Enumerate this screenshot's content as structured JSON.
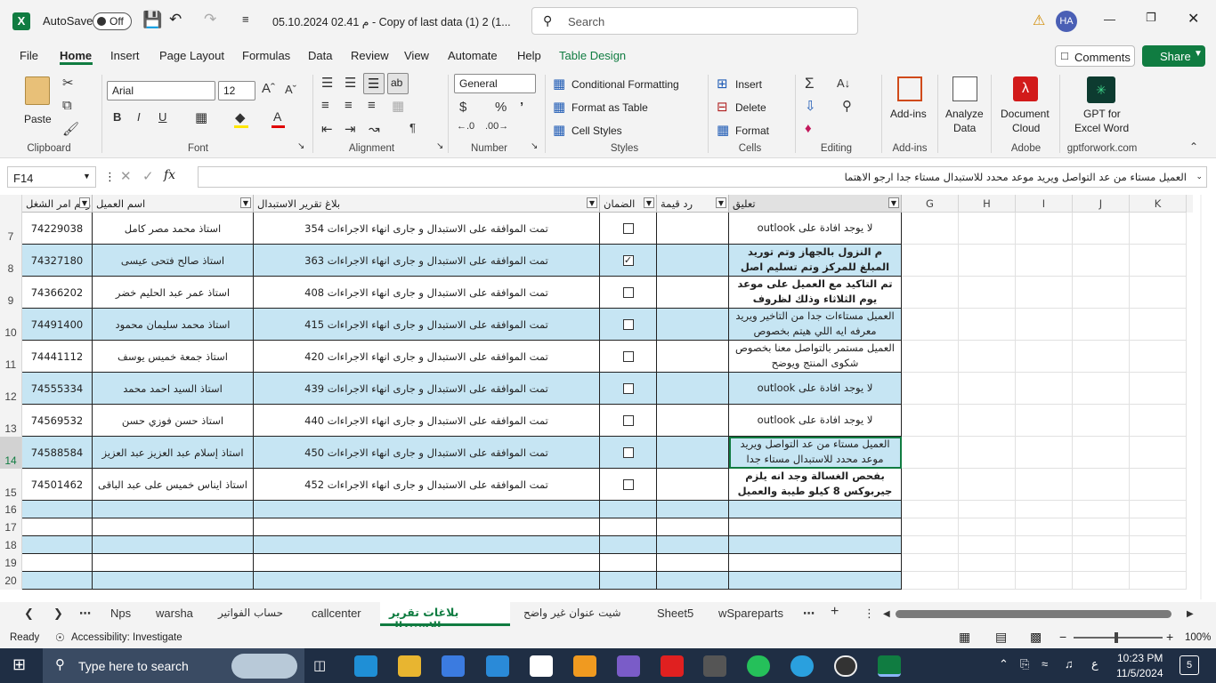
{
  "titlebar": {
    "autosave_label": "AutoSave",
    "autosave_state": "Off",
    "filename": "05.10.2024 02.41 م - Copy of last data (1) 2 (1...",
    "search_placeholder": "Search",
    "user_initials": "HA"
  },
  "menu": [
    "File",
    "Home",
    "Insert",
    "Page Layout",
    "Formulas",
    "Data",
    "Review",
    "View",
    "Automate",
    "Help",
    "Table Design"
  ],
  "menu_right": {
    "comments": "Comments",
    "share": "Share"
  },
  "ribbon": {
    "clipboard": {
      "paste": "Paste",
      "label": "Clipboard"
    },
    "font": {
      "name": "Arial",
      "size": "12",
      "label": "Font"
    },
    "alignment": {
      "label": "Alignment"
    },
    "number": {
      "format": "General",
      "label": "Number"
    },
    "styles": {
      "conditional": "Conditional Formatting",
      "table": "Format as Table",
      "cell": "Cell Styles",
      "label": "Styles"
    },
    "cells": {
      "insert": "Insert",
      "delete": "Delete",
      "format": "Format",
      "label": "Cells"
    },
    "editing": {
      "label": "Editing"
    },
    "addins": {
      "addins": "Add-ins",
      "label": "Add-ins"
    },
    "analyze": {
      "line1": "Analyze",
      "line2": "Data"
    },
    "adobe": {
      "line1": "Document",
      "line2": "Cloud",
      "label": "Adobe"
    },
    "gpt": {
      "line1": "GPT for",
      "line2": "Excel Word",
      "label": "gptforwork.com"
    }
  },
  "formula_bar": {
    "name_box": "F14",
    "fx": "fx",
    "content": "العميل مستاء من عد التواصل ويريد موعد محدد للاستبدال مستاء جدا ارجو الاهتما"
  },
  "headers": {
    "col_order": "رقم امر الشغل",
    "col_name": "اسم العميل",
    "col_report": "بلاغ تقرير الاستبدال",
    "col_warranty": "الضمان",
    "col_value": "رد قيمة",
    "col_comment": "تعليق",
    "letters": [
      "G",
      "H",
      "I",
      "J",
      "K"
    ]
  },
  "rows": [
    {
      "num": "7",
      "order": "74229038",
      "name": "استاذ محمد مصر كامل",
      "report": "تمت الموافقه على الاستبدال و جارى انهاء الاجراءات 354",
      "checked": false,
      "comment": "لا يوجد افادة على outlook"
    },
    {
      "num": "8",
      "order": "74327180",
      "name": "استاذ صالح فتحى عيسى",
      "report": "تمت الموافقه على الاستبدال و جارى انهاء الاجراءات 363",
      "checked": true,
      "comment": "م النزول بالجهاز وتم توريد المبلغ للمركز وتم تسليم اصل"
    },
    {
      "num": "9",
      "order": "74366202",
      "name": "استاذ عمر عبد الحليم خضر",
      "report": "تمت الموافقه على الاستبدال و جارى انهاء الاجراءات 408",
      "checked": false,
      "comment": "تم التاكيد مع العميل على موعد يوم الثلاثاء وذلك لظروف"
    },
    {
      "num": "10",
      "order": "74491400",
      "name": "استاذ محمد سليمان محمود",
      "report": "تمت الموافقه على الاستبدال و جارى انهاء الاجراءات 415",
      "checked": false,
      "comment": "العميل مستاءات جدا من التاخير ويريد معرفه ايه اللي هيتم بخصوص"
    },
    {
      "num": "11",
      "order": "74441112",
      "name": "استاذ جمعة خميس يوسف",
      "report": "تمت الموافقه على الاستبدال و جارى انهاء الاجراءات 420",
      "checked": false,
      "comment": "العميل مستمر بالتواصل معنا بخصوص شكوى المنتج ويوضح"
    },
    {
      "num": "12",
      "order": "74555334",
      "name": "استاذ السيد احمد محمد",
      "report": "تمت الموافقه على الاستبدال و جارى انهاء الاجراءات 439",
      "checked": false,
      "comment": "لا يوجد افادة على outlook"
    },
    {
      "num": "13",
      "order": "74569532",
      "name": "استاذ حسن فوزي حسن",
      "report": "تمت الموافقه على الاستبدال و جارى انهاء الاجراءات 440",
      "checked": false,
      "comment": "لا يوجد افادة على outlook"
    },
    {
      "num": "14",
      "order": "74588584",
      "name": "استاذ إسلام عبد العزيز عبد العزيز",
      "report": "تمت الموافقه على الاستبدال و جارى انهاء الاجراءات 450",
      "checked": false,
      "comment": "العميل مستاء من عد التواصل ويريد موعد محدد للاستبدال مستاء جدا"
    },
    {
      "num": "15",
      "order": "74501462",
      "name": "استاذ  ايناس خميس على عبد الباقى",
      "report": "تمت الموافقه على الاستبدال و جارى انهاء الاجراءات 452",
      "checked": false,
      "comment": "بفحص الغسالة وجد انه يلزم جيربوكس 8 كيلو طيبة والعميل"
    }
  ],
  "empty_rows": [
    "16",
    "17",
    "18",
    "19",
    "20"
  ],
  "sheet_tabs": [
    "Nps",
    "warsha",
    "حساب الفواتير",
    "callcenter",
    "بلاغات تقرير الاستبدال",
    "شيت عنوان غير واضح",
    "Sheet5",
    "wSpareparts"
  ],
  "active_tab": "بلاغات تقرير الاستبدال",
  "status": {
    "ready": "Ready",
    "accessibility": "Accessibility: Investigate",
    "zoom": "100%"
  },
  "taskbar": {
    "search": "Type here to search",
    "time": "10:23 PM",
    "date": "11/5/2024",
    "lang": "ع",
    "notifications": "5"
  },
  "colors": {
    "band": "#c6e5f3",
    "excel_green": "#107c41",
    "share_bg": "#107c41"
  }
}
